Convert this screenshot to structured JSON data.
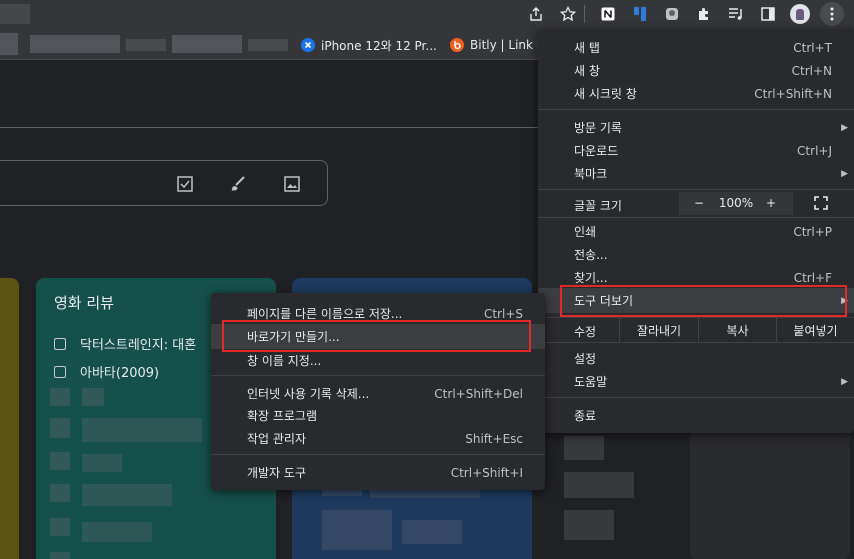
{
  "bookmarks_bar": {
    "items": [
      {
        "label": "iPhone 12와 12 Pr...",
        "color": "#1a73e8"
      },
      {
        "label": "Bitly | Link M",
        "color": "#ee6123"
      }
    ]
  },
  "notes": {
    "cards": [
      {
        "title": "영화 리뷰",
        "items": [
          "닥터스트레인지: 대혼",
          "아바타(2009)"
        ]
      }
    ]
  },
  "chrome_menu": {
    "new_tab": {
      "label": "새 탭",
      "shortcut": "Ctrl+T"
    },
    "new_window": {
      "label": "새 창",
      "shortcut": "Ctrl+N"
    },
    "incognito": {
      "label": "새 시크릿 창",
      "shortcut": "Ctrl+Shift+N"
    },
    "history": {
      "label": "방문 기록"
    },
    "downloads": {
      "label": "다운로드",
      "shortcut": "Ctrl+J"
    },
    "bookmarks": {
      "label": "북마크"
    },
    "zoom": {
      "label": "글꼴 크기",
      "minus": "−",
      "value": "100%",
      "plus": "+"
    },
    "print": {
      "label": "인쇄",
      "shortcut": "Ctrl+P"
    },
    "cast": {
      "label": "전송..."
    },
    "find": {
      "label": "찾기...",
      "shortcut": "Ctrl+F"
    },
    "more_tools": {
      "label": "도구 더보기"
    },
    "edit": {
      "label": "수정",
      "cut": "잘라내기",
      "copy": "복사",
      "paste": "붙여넣기"
    },
    "settings": {
      "label": "설정"
    },
    "help": {
      "label": "도움말"
    },
    "exit": {
      "label": "종료"
    }
  },
  "more_tools_menu": {
    "save_page": {
      "label": "페이지를 다른 이름으로 저장...",
      "shortcut": "Ctrl+S"
    },
    "create_shortcut": {
      "label": "바로가기 만들기..."
    },
    "name_window": {
      "label": "창 이름 지정..."
    },
    "clear_data": {
      "label": "인터넷 사용 기록 삭제...",
      "shortcut": "Ctrl+Shift+Del"
    },
    "extensions": {
      "label": "확장 프로그램"
    },
    "task_manager": {
      "label": "작업 관리자",
      "shortcut": "Shift+Esc"
    },
    "dev_tools": {
      "label": "개발자 도구",
      "shortcut": "Ctrl+Shift+I"
    }
  },
  "colors": {
    "card_yellow": "#5b5415",
    "card_teal": "#16504a",
    "card_blue": "#1e3a5f",
    "highlight_box": "#e02a2a"
  }
}
